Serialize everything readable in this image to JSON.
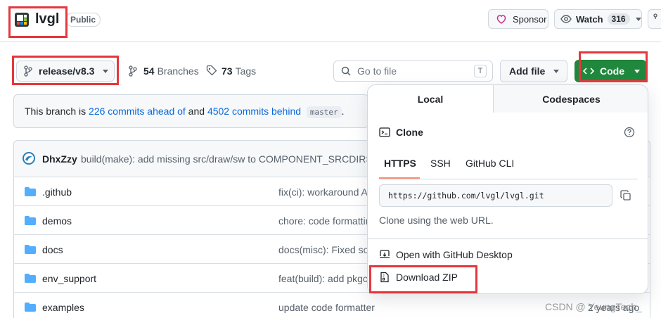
{
  "repo": {
    "name": "lvgl",
    "visibility": "Public"
  },
  "header_actions": {
    "sponsor_label": "Sponsor",
    "watch_label": "Watch",
    "watch_count": "316"
  },
  "branch_bar": {
    "branch_name": "release/v8.3",
    "branches_count": "54",
    "branches_label": "Branches",
    "tags_count": "73",
    "tags_label": "Tags",
    "goto_placeholder": "Go to file",
    "goto_shortcut": "T",
    "add_file_label": "Add file",
    "code_label": "Code"
  },
  "branch_notice": {
    "prefix": "This branch is ",
    "ahead_link": "226 commits ahead of",
    "middle": " and ",
    "behind_link": "4502 commits behind",
    "base_branch": "master",
    "suffix": "."
  },
  "commit": {
    "author": "DhxZzy",
    "message": "build(make): add missing src/draw/sw to COMPONENT_SRCDIRS ("
  },
  "files": [
    {
      "name": ".github",
      "message": "fix(ci): workaround A"
    },
    {
      "name": "demos",
      "message": "chore: code formattin"
    },
    {
      "name": "docs",
      "message": "docs(misc): Fixed sor"
    },
    {
      "name": "env_support",
      "message": "feat(build): add pkgc"
    },
    {
      "name": "examples",
      "message": "update code formatter",
      "time": "2 years ago"
    }
  ],
  "clone_panel": {
    "tab_local": "Local",
    "tab_codespaces": "Codespaces",
    "clone_title": "Clone",
    "protocols": [
      "HTTPS",
      "SSH",
      "GitHub CLI"
    ],
    "url": "https://github.com/lvgl/lvgl.git",
    "hint": "Clone using the web URL.",
    "open_desktop": "Open with GitHub Desktop",
    "download_zip": "Download ZIP"
  },
  "watermark": "CSDN @ YeungTech_",
  "colors": {
    "accent_blue": "#0969da",
    "code_green": "#1f883d",
    "highlight_red": "#e5373c",
    "sponsor_pink": "#bf3989"
  }
}
